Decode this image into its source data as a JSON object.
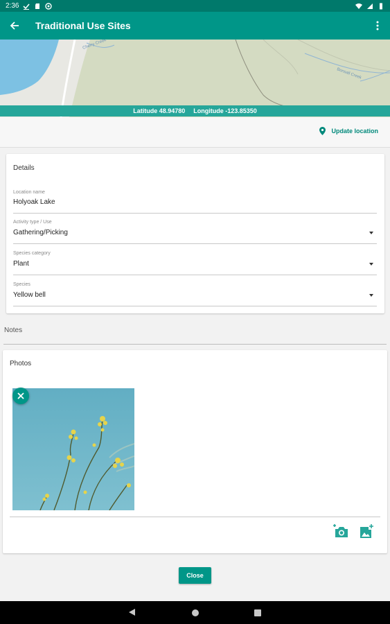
{
  "status_bar": {
    "time": "2:36"
  },
  "app_bar": {
    "title": "Traditional Use Sites"
  },
  "map": {
    "latitude_text": "Latitude 48.94780",
    "longitude_text": "Longitude -123.85350",
    "creek_labels": [
      "Cherry Creek",
      "Bonsall Creek"
    ]
  },
  "location": {
    "update_label": "Update location"
  },
  "details": {
    "title": "Details",
    "location_name": {
      "label": "Location name",
      "value": "Holyoak Lake"
    },
    "activity_type": {
      "label": "Activity type / Use",
      "value": "Gathering/Picking"
    },
    "species_category": {
      "label": "Species category",
      "value": "Plant"
    },
    "species": {
      "label": "Species",
      "value": "Yellow bell"
    }
  },
  "notes": {
    "label": "Notes"
  },
  "photos": {
    "title": "Photos"
  },
  "actions": {
    "close_label": "Close"
  },
  "colors": {
    "primary": "#009688",
    "primary_dark": "#00796b",
    "accent": "#26a69a"
  },
  "icons": [
    "arrow-back-icon",
    "more-vert-icon",
    "location-pin-icon",
    "close-icon",
    "add-photo-camera-icon",
    "add-image-icon"
  ]
}
